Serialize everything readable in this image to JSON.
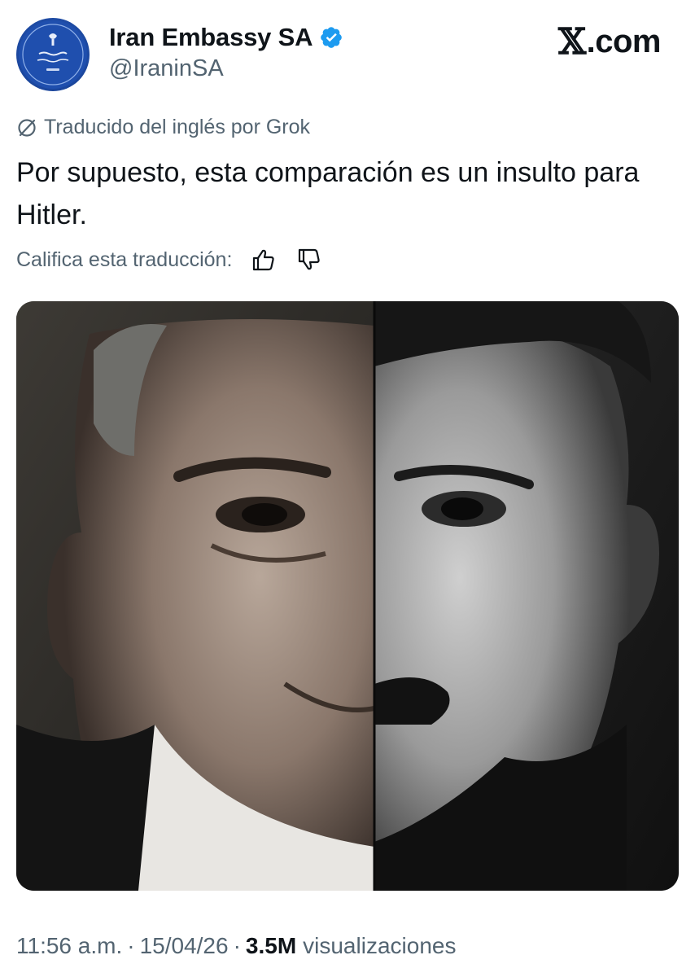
{
  "author": {
    "display_name": "Iran Embassy SA",
    "handle": "@IraninSA",
    "verified": true,
    "avatar_icon": "embassy-seal-icon"
  },
  "brand": {
    "name": "com",
    "logo_icon": "x-logo-icon"
  },
  "translation": {
    "notice": "Traducido del inglés por Grok",
    "notice_icon": "no-translate-icon",
    "rate_label": "Califica esta traducción:",
    "thumbs_up_icon": "thumbs-up-icon",
    "thumbs_down_icon": "thumbs-down-icon"
  },
  "tweet": {
    "text": "Por supuesto, esta comparación es un insulto para Hitler."
  },
  "meta": {
    "time": "11:56 a.m.",
    "date": "15/04/26",
    "views_count": "3.5M",
    "views_label": "visualizaciones",
    "separator": "·"
  },
  "colors": {
    "text_primary": "#0f1419",
    "text_secondary": "#536471",
    "verified_blue": "#1d9bf0",
    "avatar_blue": "#1d4aa3"
  }
}
